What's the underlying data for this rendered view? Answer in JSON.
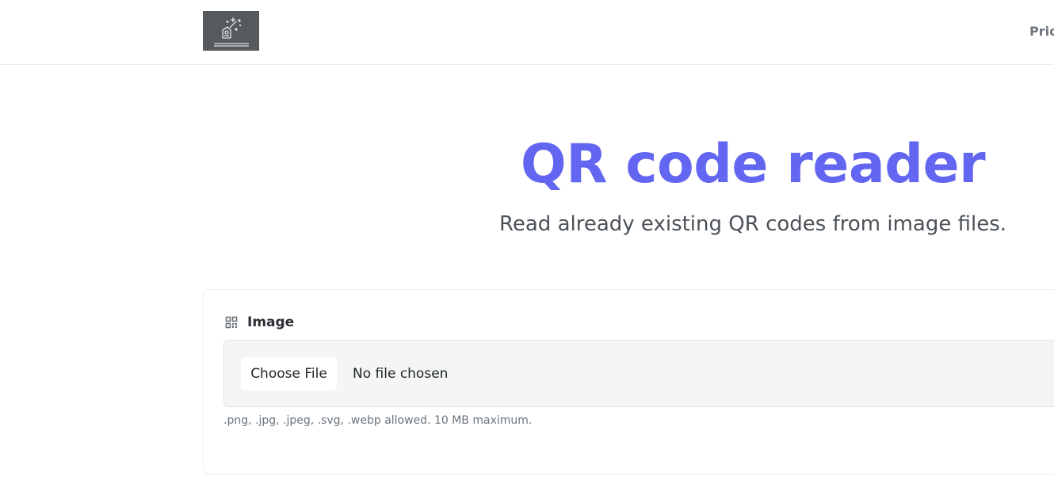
{
  "header": {
    "logo_icon": "rocket-stars-icon",
    "nav_link": "Pric"
  },
  "hero": {
    "title": "QR code reader",
    "subtitle": "Read already existing QR codes from image files."
  },
  "form": {
    "field_label": "Image",
    "field_icon": "qr-code-icon",
    "choose_button": "Choose File",
    "file_status": "No file chosen",
    "help_text": ".png, .jpg, .jpeg, .svg, .webp allowed. 10 MB maximum."
  },
  "colors": {
    "accent": "#6366f1",
    "logo_bg": "#56595d",
    "input_bg": "#f4f5f5"
  }
}
